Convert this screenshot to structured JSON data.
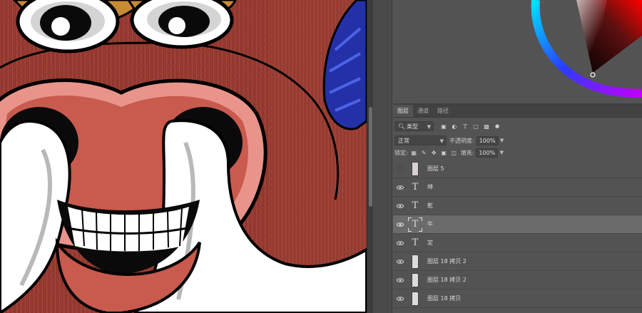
{
  "layers_panel": {
    "tabs": [
      {
        "label": "图层",
        "active": true
      },
      {
        "label": "通道",
        "active": false
      },
      {
        "label": "路径",
        "active": false
      }
    ],
    "filter": {
      "kind_label": "类型",
      "icons": [
        "image-filter-icon",
        "adjustment-filter-icon",
        "text-filter-icon",
        "shape-filter-icon",
        "smart-object-filter-icon",
        "filter-toggle-icon"
      ]
    },
    "blend_mode": "正常",
    "opacity_label": "不透明度:",
    "opacity_value": "100%",
    "lock_label": "锁定:",
    "fill_label": "填充:",
    "fill_value": "100%",
    "layers": [
      {
        "name": "图层 5",
        "type": "pixel",
        "visible": false,
        "selected": false
      },
      {
        "name": "坤",
        "type": "text",
        "visible": true,
        "selected": false
      },
      {
        "name": "乾",
        "type": "text",
        "visible": true,
        "selected": false
      },
      {
        "name": "牛",
        "type": "text",
        "visible": true,
        "selected": true
      },
      {
        "name": "定",
        "type": "text",
        "visible": true,
        "selected": false
      },
      {
        "name": "图层 18 拷贝 2",
        "type": "pixel",
        "visible": true,
        "selected": false
      },
      {
        "name": "图层 18 拷贝 2",
        "type": "pixel",
        "visible": true,
        "selected": false
      },
      {
        "name": "图层 18 拷贝",
        "type": "pixel",
        "visible": true,
        "selected": false
      }
    ],
    "text_glyph": "T"
  },
  "colors": {
    "canvas_skin": "#a2443a",
    "nose": "#c85a4e",
    "nose_light": "#e8948a",
    "dock_bg": "#535353",
    "selected_row": "#6b6b6b"
  }
}
